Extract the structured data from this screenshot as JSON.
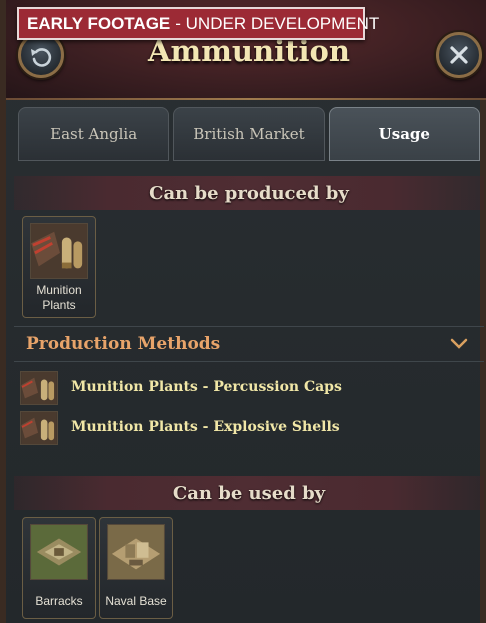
{
  "banner": {
    "bold": "EARLY FOOTAGE",
    "rest": "- UNDER DEVELOPMENT"
  },
  "header": {
    "title": "Ammunition"
  },
  "tabs": [
    {
      "label": "East Anglia",
      "active": false
    },
    {
      "label": "British Market",
      "active": false
    },
    {
      "label": "Usage",
      "active": true
    }
  ],
  "produced": {
    "heading": "Can be produced by",
    "items": [
      {
        "label_line1": "Munition",
        "label_line2": "Plants"
      }
    ]
  },
  "production_methods": {
    "heading": "Production Methods",
    "rows": [
      {
        "text": "Munition Plants - Percussion Caps"
      },
      {
        "text": "Munition Plants - Explosive Shells"
      }
    ]
  },
  "used": {
    "heading": "Can be used by",
    "items": [
      {
        "label": "Barracks"
      },
      {
        "label": "Naval Base"
      }
    ]
  },
  "colors": {
    "banner": "#9c2a35",
    "title": "#f3e6b4",
    "pm_heading": "#e8a46a",
    "pm_text": "#f1e7a7"
  }
}
